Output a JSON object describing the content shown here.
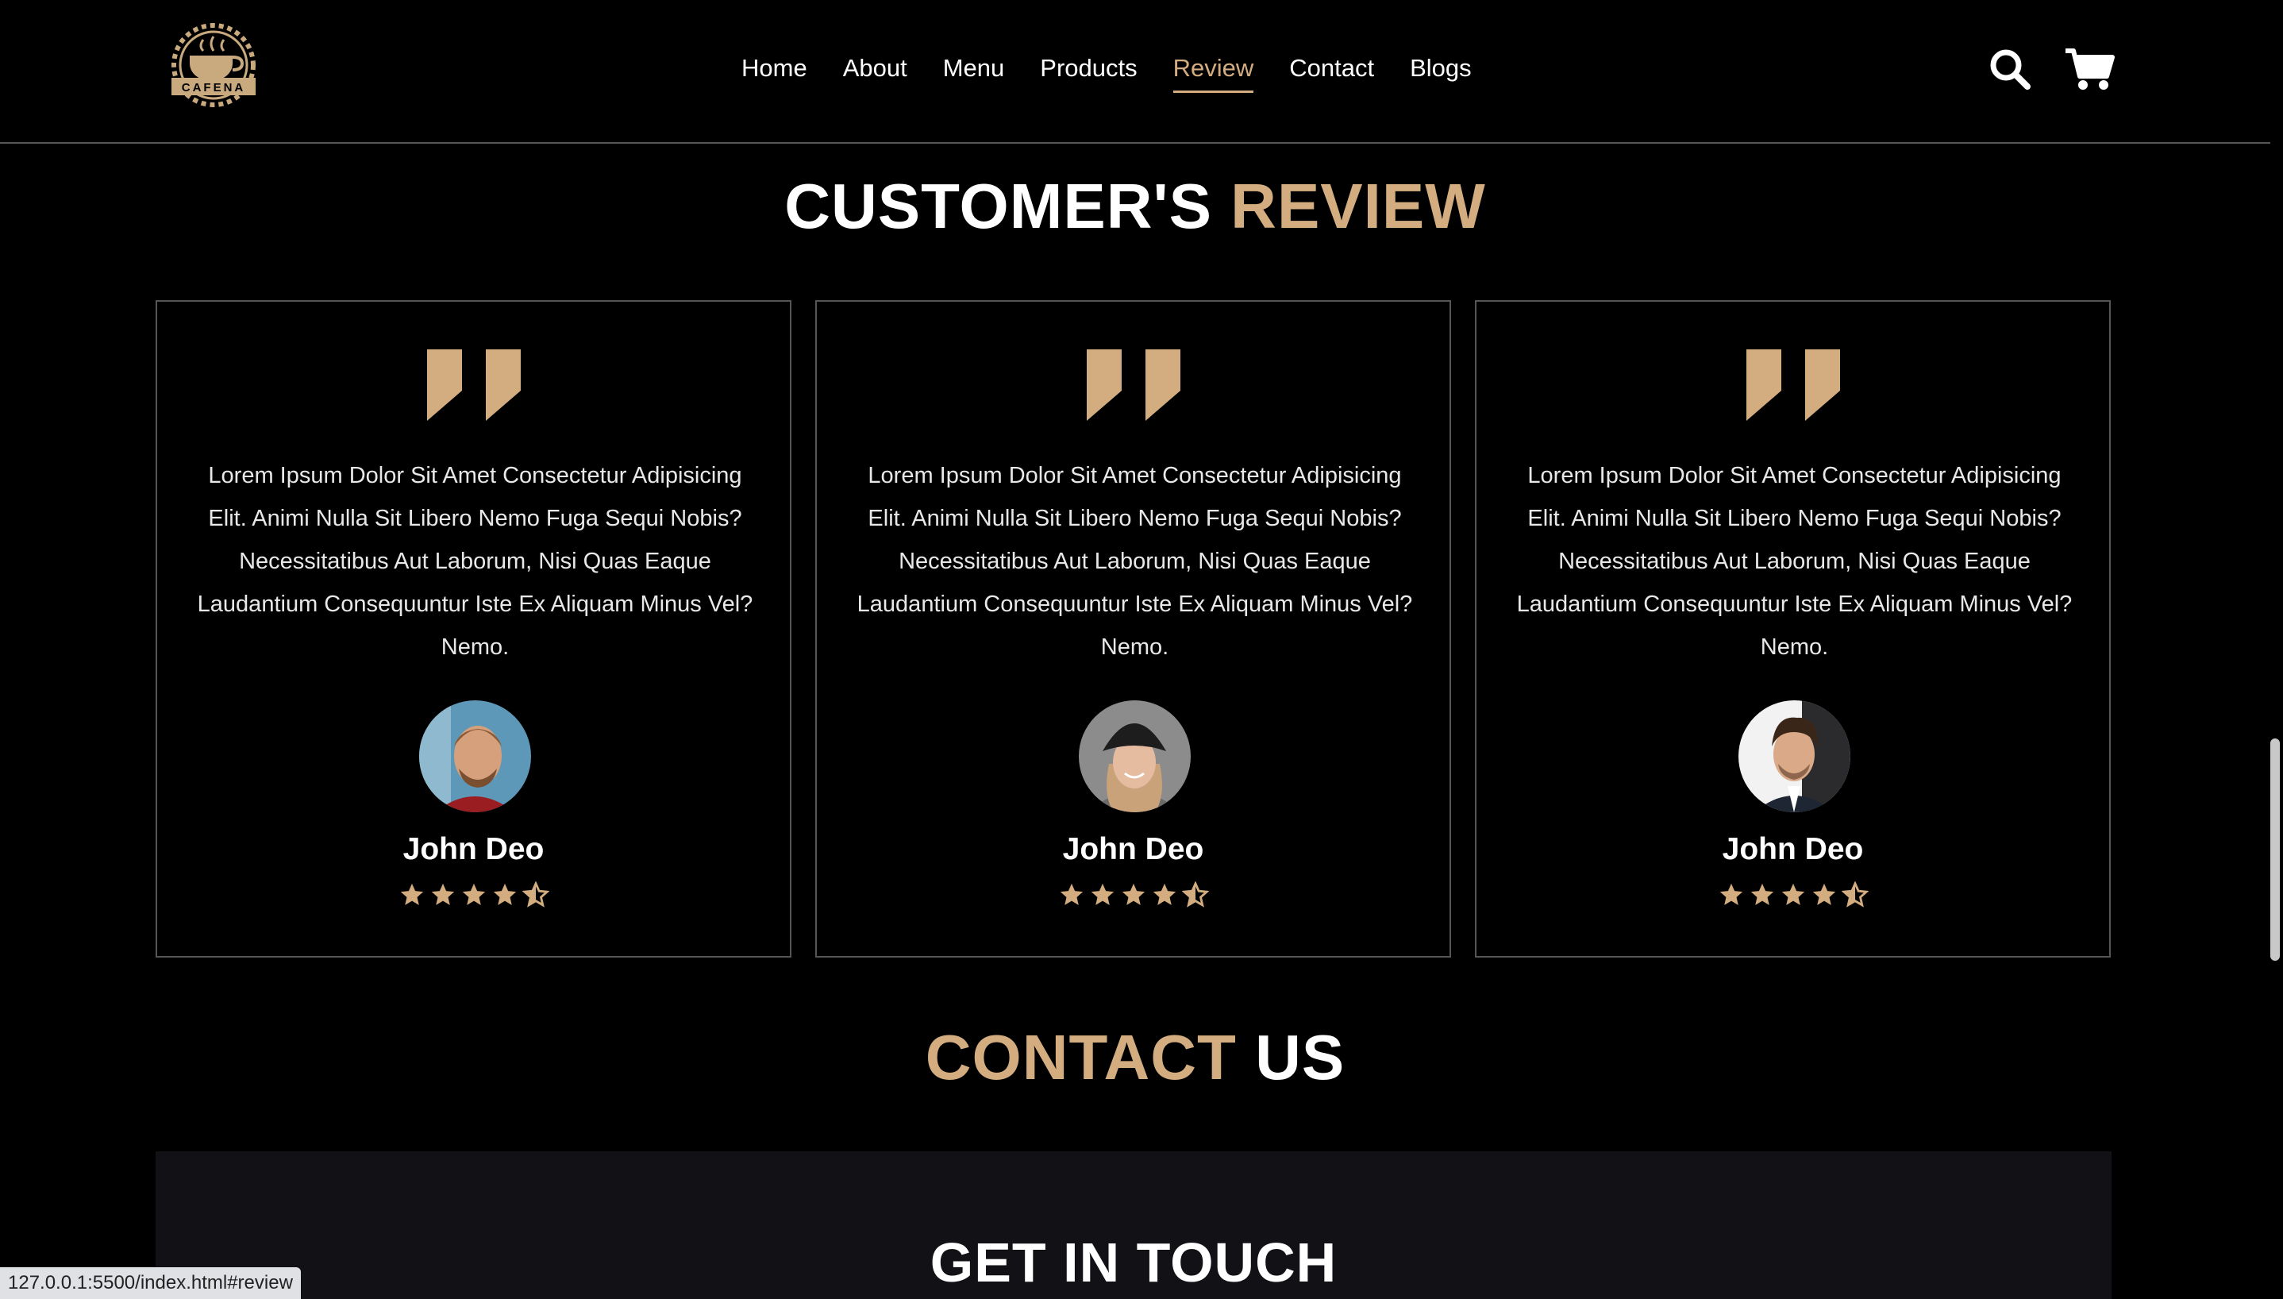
{
  "header": {
    "logo_text": "CAFENA",
    "nav": [
      {
        "label": "Home"
      },
      {
        "label": "About"
      },
      {
        "label": "Menu"
      },
      {
        "label": "Products"
      },
      {
        "label": "Review",
        "active": true
      },
      {
        "label": "Contact"
      },
      {
        "label": "Blogs"
      }
    ],
    "icons": {
      "search": "search-icon",
      "cart": "shopping-cart-icon"
    }
  },
  "review_section": {
    "title_main": "CUSTOMER'S",
    "title_accent": "REVIEW",
    "cards": [
      {
        "text": "Lorem Ipsum Dolor Sit Amet Consectetur Adipisicing Elit. Animi Nulla Sit Libero Nemo Fuga Sequi Nobis? Necessitatibus Aut Laborum, Nisi Quas Eaque Laudantium Consequuntur Iste Ex Aliquam Minus Vel? Nemo.",
        "name": "John Deo",
        "rating": 4.5,
        "avatar": "man-with-beard-photo"
      },
      {
        "text": "Lorem Ipsum Dolor Sit Amet Consectetur Adipisicing Elit. Animi Nulla Sit Libero Nemo Fuga Sequi Nobis? Necessitatibus Aut Laborum, Nisi Quas Eaque Laudantium Consequuntur Iste Ex Aliquam Minus Vel? Nemo.",
        "name": "John Deo",
        "rating": 4.5,
        "avatar": "woman-in-beanie-photo"
      },
      {
        "text": "Lorem Ipsum Dolor Sit Amet Consectetur Adipisicing Elit. Animi Nulla Sit Libero Nemo Fuga Sequi Nobis? Necessitatibus Aut Laborum, Nisi Quas Eaque Laudantium Consequuntur Iste Ex Aliquam Minus Vel? Nemo.",
        "name": "John Deo",
        "rating": 4.5,
        "avatar": "man-in-suit-photo"
      }
    ]
  },
  "contact_section": {
    "title_accent": "CONTACT",
    "title_main": "US",
    "panel_title": "GET IN TOUCH"
  },
  "status_bar": {
    "url": "127.0.0.1:5500/index.html#review"
  },
  "colors": {
    "background": "#000000",
    "accent": "#d3ad7f",
    "border": "#555555",
    "panel": "#121115"
  }
}
